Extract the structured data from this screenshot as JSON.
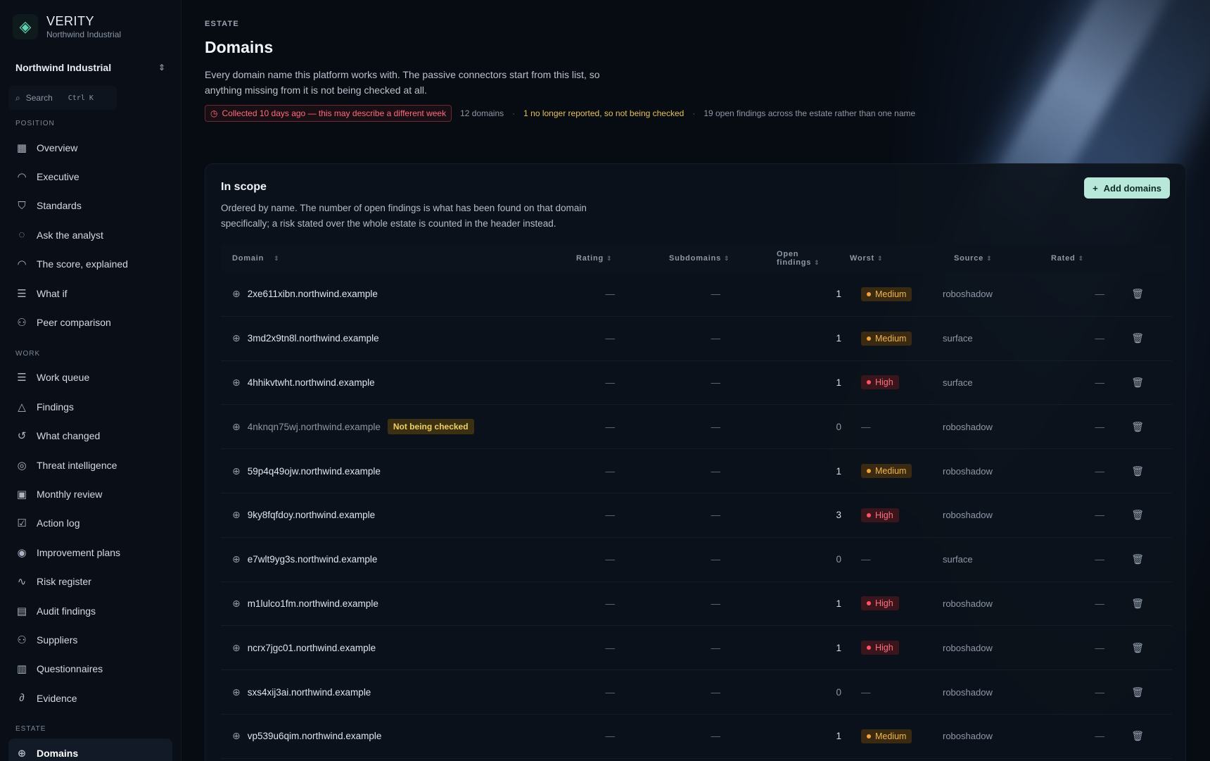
{
  "brand": {
    "name": "VERITY",
    "subtitle": "Northwind Industrial"
  },
  "org_switcher": {
    "label": "Northwind Industrial"
  },
  "search": {
    "placeholder": "Search",
    "shortcut": "Ctrl K"
  },
  "sidebar": {
    "sections": [
      {
        "label": "POSITION",
        "items": [
          {
            "label": "Overview",
            "icon": "grid-icon"
          },
          {
            "label": "Executive",
            "icon": "gauge-icon"
          },
          {
            "label": "Standards",
            "icon": "shield-icon"
          },
          {
            "label": "Ask the analyst",
            "icon": "chat-icon"
          },
          {
            "label": "The score, explained",
            "icon": "gauge-icon"
          },
          {
            "label": "What if",
            "icon": "sliders-icon"
          },
          {
            "label": "Peer comparison",
            "icon": "users-icon"
          }
        ]
      },
      {
        "label": "WORK",
        "items": [
          {
            "label": "Work queue",
            "icon": "list-icon"
          },
          {
            "label": "Findings",
            "icon": "warning-icon"
          },
          {
            "label": "What changed",
            "icon": "history-icon"
          },
          {
            "label": "Threat intelligence",
            "icon": "radar-icon"
          },
          {
            "label": "Monthly review",
            "icon": "calendar-icon"
          },
          {
            "label": "Action log",
            "icon": "checklist-icon"
          },
          {
            "label": "Improvement plans",
            "icon": "target-icon"
          },
          {
            "label": "Risk register",
            "icon": "pulse-icon"
          },
          {
            "label": "Audit findings",
            "icon": "clipboard-icon"
          },
          {
            "label": "Suppliers",
            "icon": "users-icon"
          },
          {
            "label": "Questionnaires",
            "icon": "form-icon"
          },
          {
            "label": "Evidence",
            "icon": "paperclip-icon"
          }
        ]
      },
      {
        "label": "ESTATE",
        "items": [
          {
            "label": "Domains",
            "icon": "globe-icon",
            "active": true
          }
        ]
      }
    ]
  },
  "header": {
    "eyebrow": "ESTATE",
    "title": "Domains",
    "description": "Every domain name this platform works with. The passive connectors start from this list, so anything missing from it is not being checked at all.",
    "stale_notice": "Collected 10 days ago — this may describe a different week",
    "domain_count": "12 domains",
    "unchecked_notice": "1 no longer reported, so not being checked",
    "estate_findings": "19 open findings across the estate rather than one name"
  },
  "card": {
    "title": "In scope",
    "description": "Ordered by name. The number of open findings is what has been found on that domain specifically; a risk stated over the whole estate is counted in the header instead.",
    "add_button": "Add domains"
  },
  "table": {
    "columns": [
      "Domain",
      "Rating",
      "Subdomains",
      "Open findings",
      "Worst",
      "Source",
      "Rated"
    ],
    "rows": [
      {
        "domain": "2xe611xibn.northwind.example",
        "rating": "—",
        "subdomains": "—",
        "open": "1",
        "worst": "Medium",
        "source": "roboshadow",
        "rated": "—"
      },
      {
        "domain": "3md2x9tn8l.northwind.example",
        "rating": "—",
        "subdomains": "—",
        "open": "1",
        "worst": "Medium",
        "source": "surface",
        "rated": "—"
      },
      {
        "domain": "4hhikvtwht.northwind.example",
        "rating": "—",
        "subdomains": "—",
        "open": "1",
        "worst": "High",
        "source": "surface",
        "rated": "—"
      },
      {
        "domain": "4nknqn75wj.northwind.example",
        "tag": "Not being checked",
        "rating": "—",
        "subdomains": "—",
        "open": "0",
        "worst": "—",
        "source": "roboshadow",
        "rated": "—"
      },
      {
        "domain": "59p4q49ojw.northwind.example",
        "rating": "—",
        "subdomains": "—",
        "open": "1",
        "worst": "Medium",
        "source": "roboshadow",
        "rated": "—"
      },
      {
        "domain": "9ky8fqfdoy.northwind.example",
        "rating": "—",
        "subdomains": "—",
        "open": "3",
        "worst": "High",
        "source": "roboshadow",
        "rated": "—"
      },
      {
        "domain": "e7wlt9yg3s.northwind.example",
        "rating": "—",
        "subdomains": "—",
        "open": "0",
        "worst": "—",
        "source": "surface",
        "rated": "—"
      },
      {
        "domain": "m1lulco1fm.northwind.example",
        "rating": "—",
        "subdomains": "—",
        "open": "1",
        "worst": "High",
        "source": "roboshadow",
        "rated": "—"
      },
      {
        "domain": "ncrx7jgc01.northwind.example",
        "rating": "—",
        "subdomains": "—",
        "open": "1",
        "worst": "High",
        "source": "roboshadow",
        "rated": "—"
      },
      {
        "domain": "sxs4xij3ai.northwind.example",
        "rating": "—",
        "subdomains": "—",
        "open": "0",
        "worst": "—",
        "source": "roboshadow",
        "rated": "—"
      },
      {
        "domain": "vp539u6qim.northwind.example",
        "rating": "—",
        "subdomains": "—",
        "open": "1",
        "worst": "Medium",
        "source": "roboshadow",
        "rated": "—"
      }
    ]
  },
  "colors": {
    "accent": "#b8e8da",
    "medium": "#f2b64a",
    "high": "#ff6f7d",
    "warning": "#e8c15a",
    "stale": "#ff6b7c"
  }
}
